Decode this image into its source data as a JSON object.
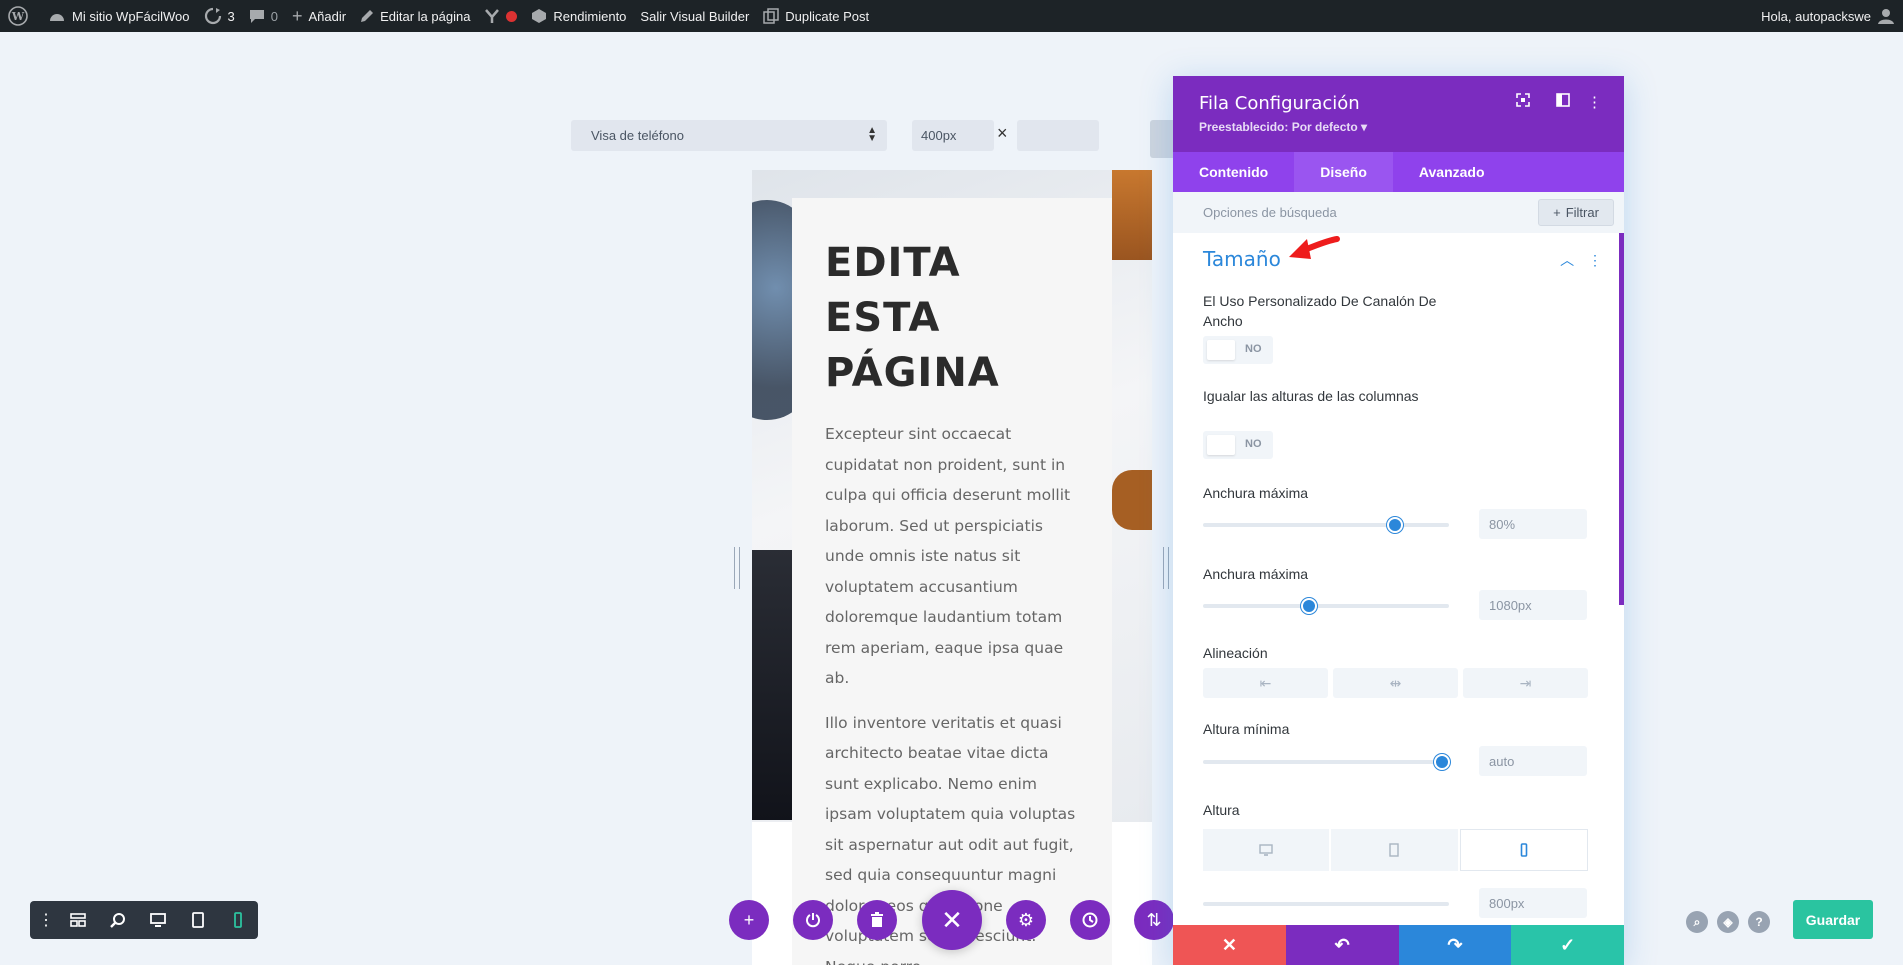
{
  "adminbar": {
    "site_name": "Mi sitio WpFácilWoo",
    "updates_count": "3",
    "comments_count": "0",
    "add_label": "Añadir",
    "edit_page_label": "Editar la página",
    "performance_label": "Rendimiento",
    "exit_builder_label": "Salir Visual Builder",
    "duplicate_label": "Duplicate Post",
    "greeting": "Hola, autopackswe"
  },
  "preview": {
    "view_select": "Visa de teléfono",
    "width_value": "400px",
    "times_symbol": "×"
  },
  "page_content": {
    "heading_line1": "EDITA",
    "heading_line2": "ESTA",
    "heading_line3": "PÁGINA",
    "para1": "Excepteur sint occaecat cupidatat non proident, sunt in culpa qui officia deserunt mollit laborum. Sed ut perspiciatis unde omnis iste natus sit voluptatem accusantium doloremque laudantium totam rem aperiam, eaque ipsa quae ab.",
    "para2": "Illo inventore veritatis et quasi architecto beatae vitae dicta sunt explicabo. Nemo enim ipsam voluptatem quia voluptas sit aspernatur aut odit aut fugit, sed quia consequuntur magni dolores eos qui ratione voluptatem sequi nesciunt. Neque porro"
  },
  "modal": {
    "title": "Fila Configuración",
    "preset": "Preestablecido: Por defecto ▾",
    "tabs": [
      "Contenido",
      "Diseño",
      "Avanzado"
    ],
    "search_placeholder": "Opciones de búsqueda",
    "filter_label": "Filtrar",
    "section_title": "Tamaño",
    "fields": {
      "custom_gutter_label": "El Uso Personalizado De Canalón De Ancho",
      "custom_gutter_value": "NO",
      "equal_heights_label": "Igualar las alturas de las columnas",
      "equal_heights_value": "NO",
      "max_width_label": "Anchura máxima",
      "max_width_value": "80%",
      "max_width_level": 0.78,
      "max_width2_label": "Anchura máxima",
      "max_width2_value": "1080px",
      "max_width2_level": 0.43,
      "alignment_label": "Alineación",
      "min_height_label": "Altura mínima",
      "min_height_value": "auto",
      "min_height_level": 0.97,
      "height_label": "Altura",
      "height_partial_value": "800px"
    }
  },
  "toolbar": {
    "save_label": "Guardar"
  },
  "colors": {
    "accent_purple": "#7b2cbf",
    "accent_blue": "#2b87da",
    "accent_green": "#2ac4a0",
    "accent_red": "#ef5555"
  }
}
